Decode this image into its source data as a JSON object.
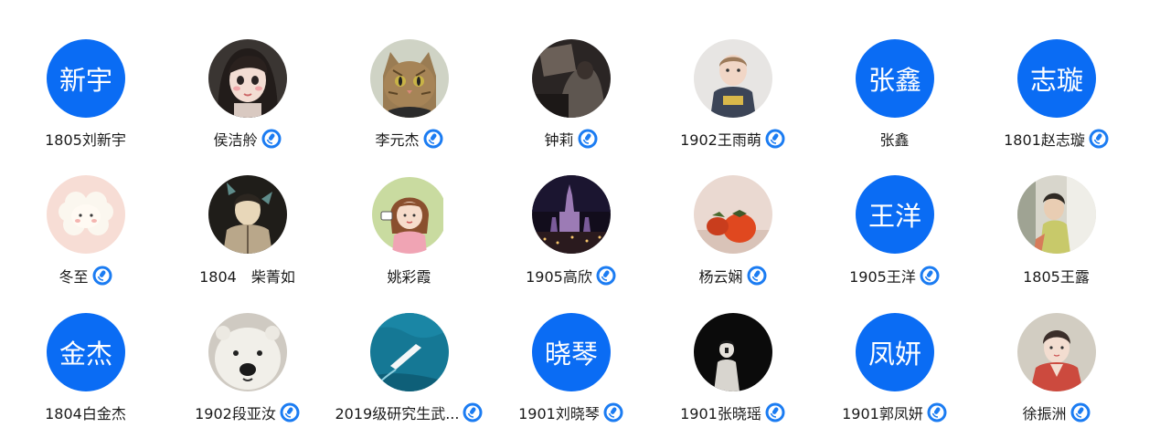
{
  "contacts": [
    {
      "name": "1805刘新宇",
      "avatar_text": "新宇",
      "avatar_type": "text",
      "verified": false
    },
    {
      "name": "侯洁舲",
      "avatar_type": "photo-girl-cartoon",
      "verified": true
    },
    {
      "name": "李元杰",
      "avatar_type": "photo-cat",
      "verified": true
    },
    {
      "name": "钟莉",
      "avatar_type": "photo-car-window",
      "verified": true
    },
    {
      "name": "1902王雨萌",
      "avatar_type": "photo-child",
      "verified": true
    },
    {
      "name": "张鑫",
      "avatar_text": "张鑫",
      "avatar_type": "text",
      "verified": false
    },
    {
      "name": "1801赵志璇",
      "avatar_text": "志璇",
      "avatar_type": "text",
      "verified": true
    },
    {
      "name": "冬至",
      "avatar_type": "photo-sheep",
      "verified": true
    },
    {
      "name": "1804　柴菁如",
      "avatar_type": "photo-butterfly-girl",
      "verified": false
    },
    {
      "name": "姚彩霞",
      "avatar_type": "photo-cartoon-girl",
      "verified": false
    },
    {
      "name": "1905高欣",
      "avatar_type": "photo-castle-night",
      "verified": true
    },
    {
      "name": "杨云娴",
      "avatar_type": "photo-persimmon",
      "verified": true
    },
    {
      "name": "1905王洋",
      "avatar_text": "王洋",
      "avatar_type": "text",
      "verified": true
    },
    {
      "name": "1805王露",
      "avatar_type": "photo-window-girl",
      "verified": false
    },
    {
      "name": "1804白金杰",
      "avatar_text": "金杰",
      "avatar_type": "text",
      "verified": false
    },
    {
      "name": "1902段亚汝",
      "avatar_type": "photo-polar-bear",
      "verified": true
    },
    {
      "name": "2019级研究生武...",
      "avatar_type": "photo-boat-sea",
      "verified": true
    },
    {
      "name": "1901刘晓琴",
      "avatar_text": "晓琴",
      "avatar_type": "text",
      "verified": true
    },
    {
      "name": "1901张晓瑶",
      "avatar_type": "photo-dark-person",
      "verified": true
    },
    {
      "name": "1901郭凤妍",
      "avatar_text": "凤妍",
      "avatar_type": "text",
      "verified": true
    },
    {
      "name": "徐振洲",
      "avatar_type": "photo-painting-boy",
      "verified": true
    }
  ],
  "colors": {
    "avatar_blue": "#0a6cf4",
    "badge_blue": "#1b7cf2"
  },
  "badge_icon": "verified-mic-badge-icon"
}
